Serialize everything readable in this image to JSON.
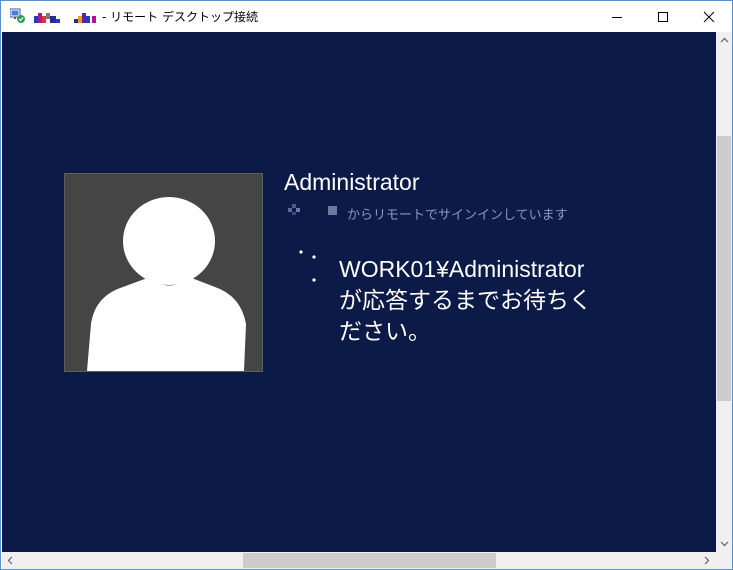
{
  "window": {
    "title": "- リモート デスクトップ接続",
    "controls": {
      "minimize_icon": "minimize-icon",
      "maximize_icon": "maximize-icon",
      "close_icon": "close-icon"
    }
  },
  "session": {
    "username": "Administrator",
    "signin_status": "からリモートでサインインしています",
    "message": "WORK01¥Administrator が応答するまでお待ちください。"
  },
  "colors": {
    "desktop_background": "#0b1a46",
    "avatar_background": "#454545",
    "text_primary": "#ffffff",
    "text_secondary": "#8d97b8"
  }
}
